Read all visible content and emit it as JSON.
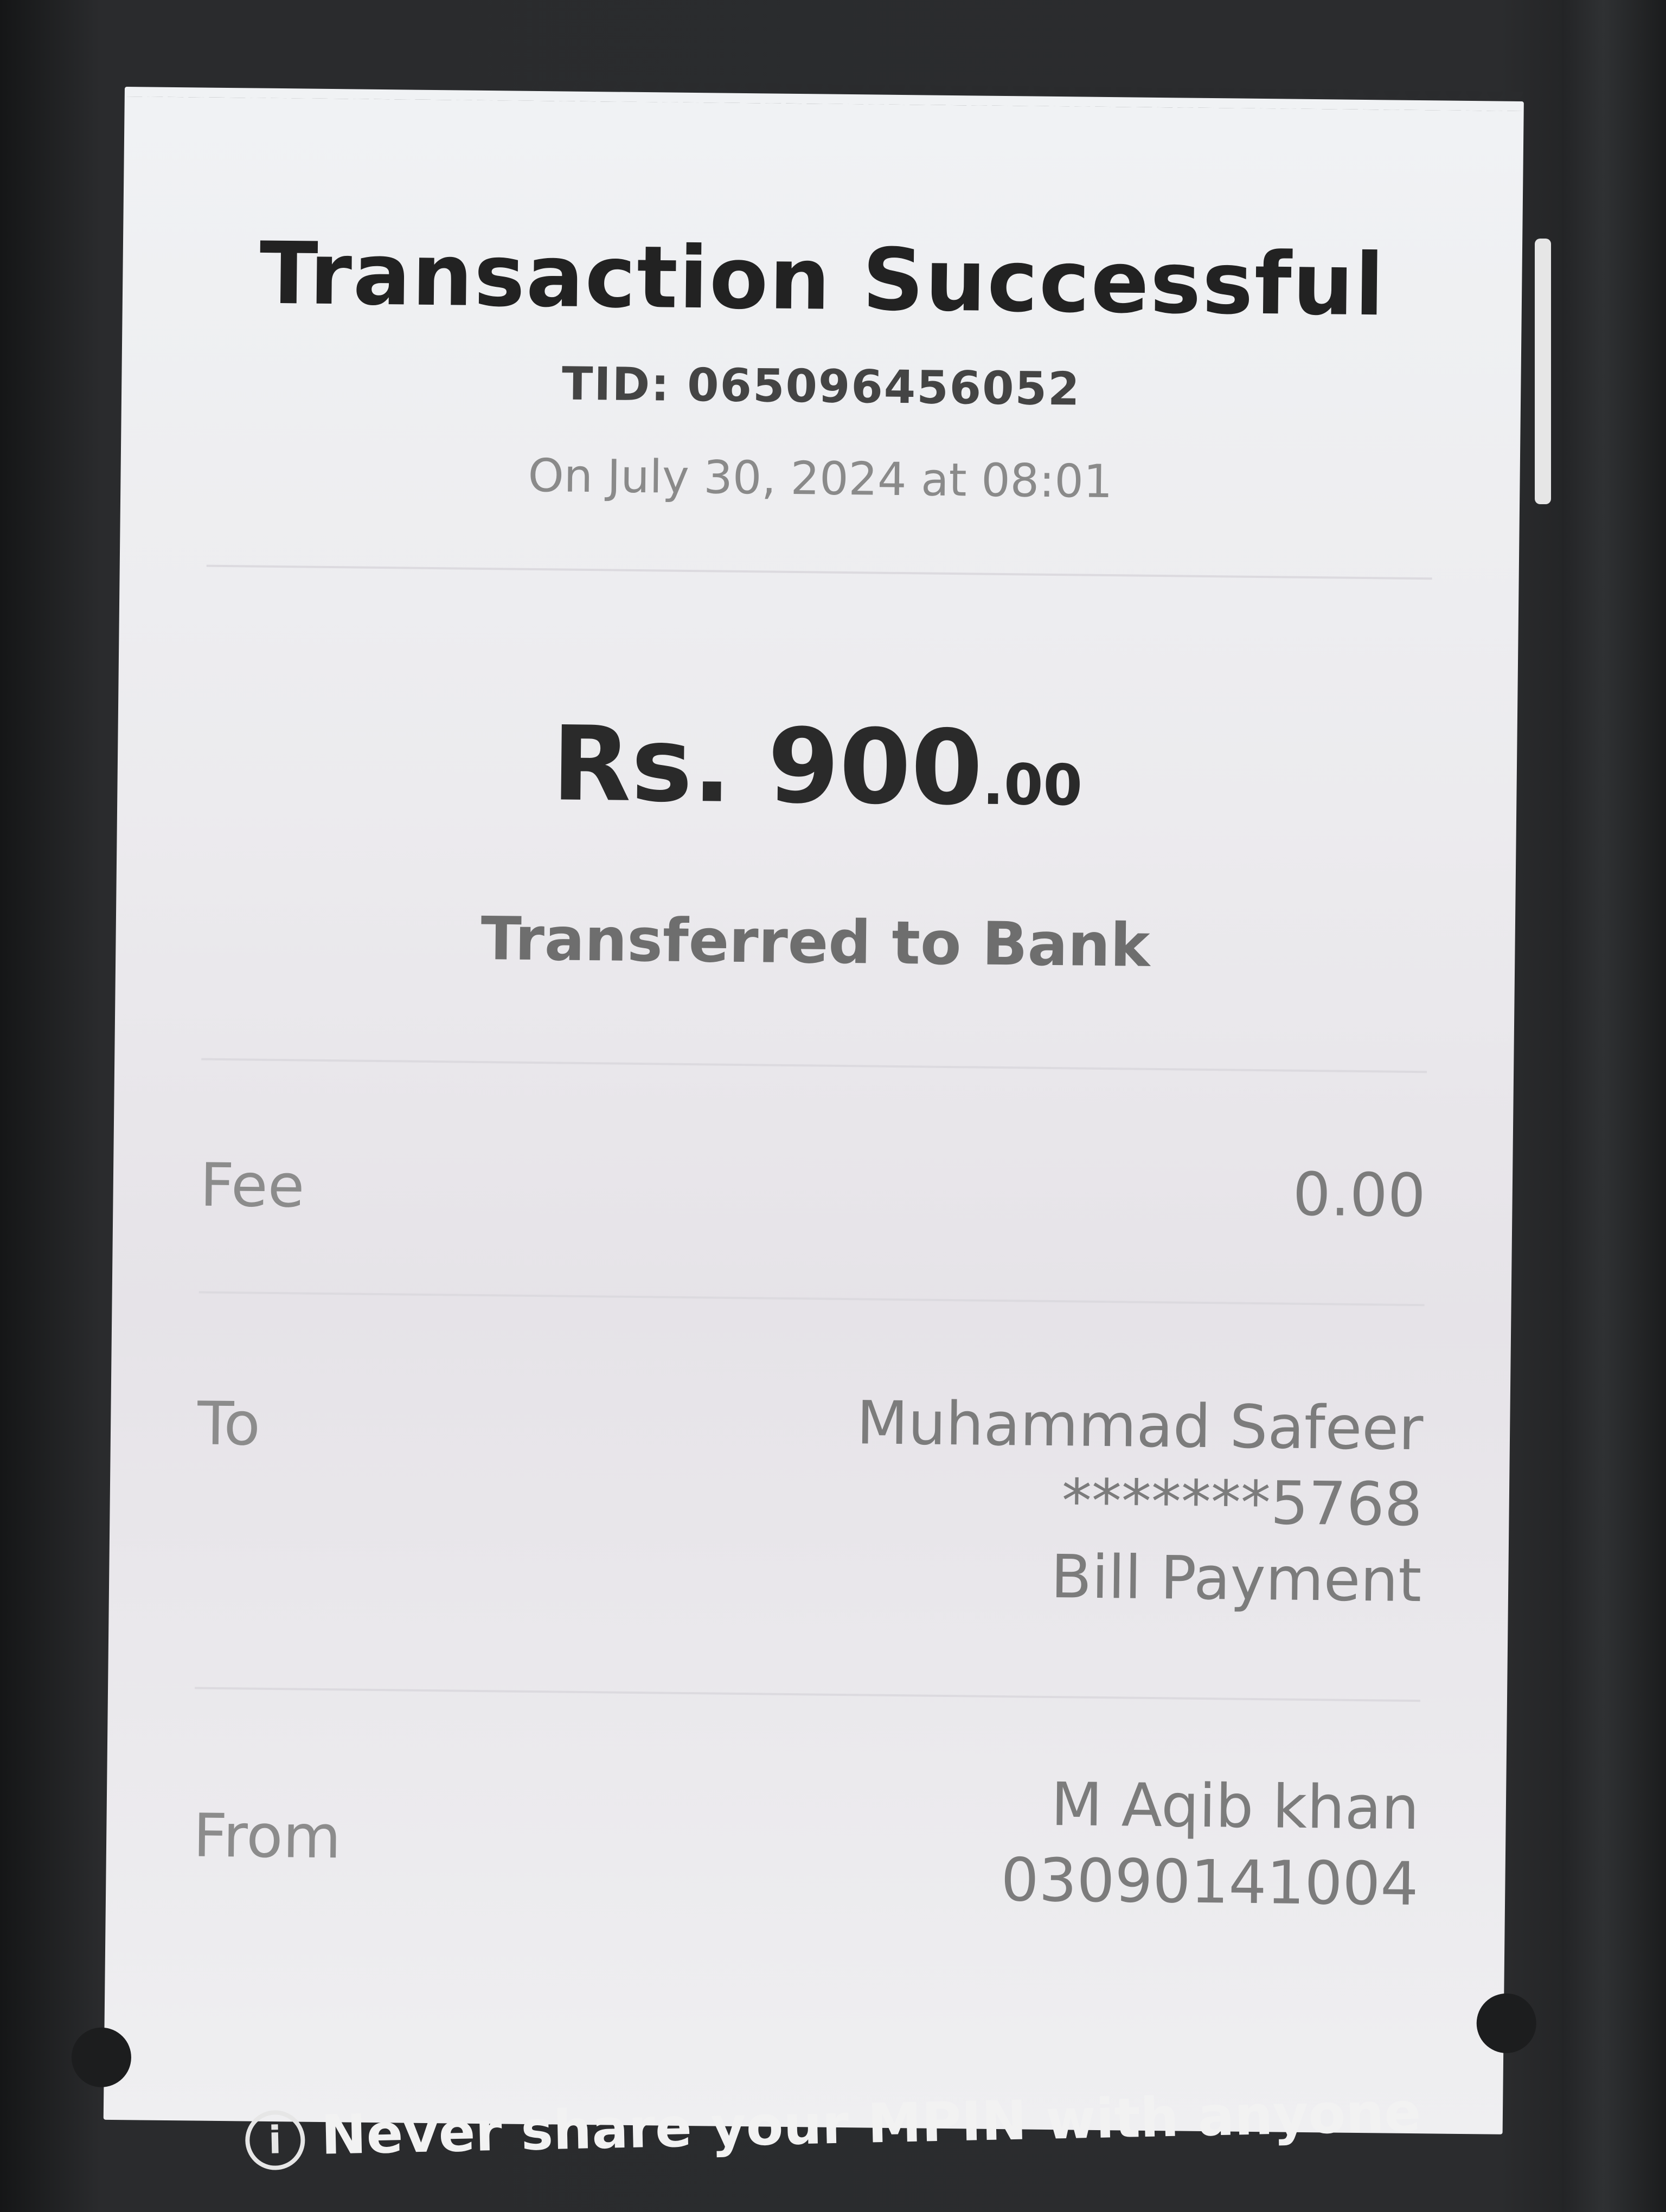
{
  "receipt": {
    "title": "Transaction Successful",
    "tid": "TID: 065096456052",
    "datetime": "On July 30, 2024 at 08:01",
    "amount_main": "Rs. 900",
    "amount_cents": ".00",
    "description": "Transferred to Bank"
  },
  "fee": {
    "label": "Fee",
    "value": "0.00"
  },
  "to": {
    "label": "To",
    "name": "Muhammad Safeer",
    "account": "*******5768",
    "purpose": "Bill Payment"
  },
  "from": {
    "label": "From",
    "name": "M Aqib khan",
    "number": "03090141004"
  },
  "footer": {
    "icon": "info-icon",
    "text": "Never share your MPIN with anyone"
  }
}
